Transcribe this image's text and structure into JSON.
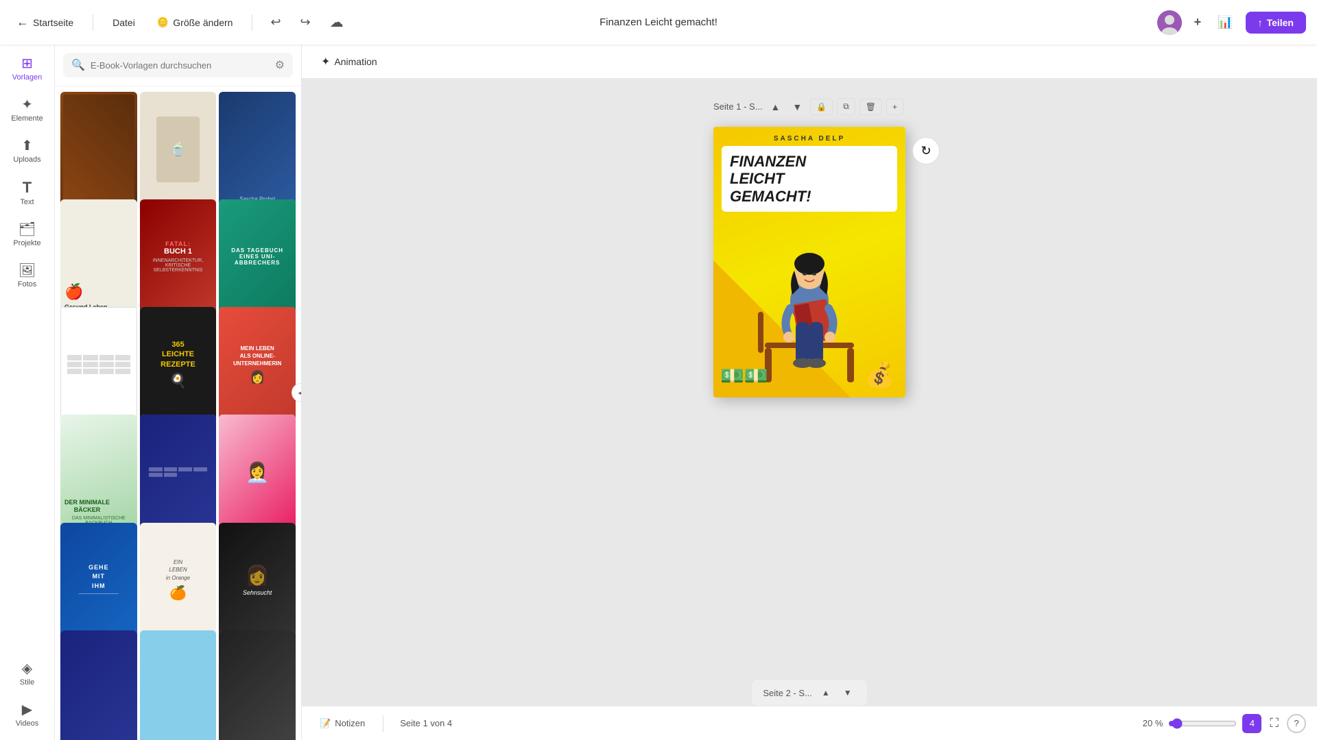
{
  "header": {
    "home_label": "Startseite",
    "file_label": "Datei",
    "resize_label": "Größe ändern",
    "undo_icon": "↩",
    "redo_icon": "↪",
    "cloud_icon": "☁",
    "title": "Finanzen Leicht gemacht!",
    "plus_icon": "+",
    "chart_icon": "📊",
    "share_label": "Teilen"
  },
  "sidebar": {
    "items": [
      {
        "id": "vorlagen",
        "label": "Vorlagen",
        "icon": "⊞",
        "active": true
      },
      {
        "id": "elemente",
        "label": "Elemente",
        "icon": "✦"
      },
      {
        "id": "uploads",
        "label": "Uploads",
        "icon": "⬆"
      },
      {
        "id": "text",
        "label": "Text",
        "icon": "T"
      },
      {
        "id": "projekte",
        "label": "Projekte",
        "icon": "□"
      },
      {
        "id": "fotos",
        "label": "Fotos",
        "icon": "🖼"
      },
      {
        "id": "stile",
        "label": "Stile",
        "icon": "◈"
      },
      {
        "id": "videos",
        "label": "Videos",
        "icon": "▶"
      }
    ]
  },
  "panel": {
    "search_placeholder": "E-Book-Vorlagen durchsuchen",
    "filter_icon": "⚙",
    "books": [
      {
        "id": 1,
        "title": "",
        "style": "book-cover-1"
      },
      {
        "id": 2,
        "title": "",
        "style": "book-cover-2"
      },
      {
        "id": 3,
        "title": "Sascha Probst",
        "style": "book-cover-3"
      },
      {
        "id": 4,
        "title": "Gesund Leben",
        "style": "book-cover-4"
      },
      {
        "id": 5,
        "title": "FATAL: BUCH 1",
        "style": "book-cover-5"
      },
      {
        "id": 6,
        "title": "DAS TAGEBUCH EINES UNI-ABBRECHERS",
        "style": "book-cover-6"
      },
      {
        "id": 7,
        "title": "",
        "style": "book-cover-7"
      },
      {
        "id": 8,
        "title": "365 LEICHTE REZEPTE",
        "style": "book-cover-8"
      },
      {
        "id": 9,
        "title": "MEIN LEBEN ALS ONLINE-UNTERNEHMERIN",
        "style": "book-cover-9"
      },
      {
        "id": 10,
        "title": "DER MINIMALE BÄCKER",
        "style": "book-cover-10"
      },
      {
        "id": 11,
        "title": "",
        "style": "book-cover-11"
      },
      {
        "id": 12,
        "title": "",
        "style": "book-cover-12"
      },
      {
        "id": 13,
        "title": "GEHE MIT IHM",
        "style": "book-cover-13"
      },
      {
        "id": 14,
        "title": "EIN LEBEN in Orange",
        "style": "book-cover-14"
      },
      {
        "id": 15,
        "title": "SEHNSUCHT",
        "style": "book-cover-15"
      },
      {
        "id": 16,
        "title": "",
        "style": "book-cover-16"
      },
      {
        "id": 17,
        "title": "",
        "style": "book-cover-17"
      },
      {
        "id": 18,
        "title": "",
        "style": "book-cover-18"
      }
    ]
  },
  "canvas": {
    "animation_label": "Animation",
    "page1_label": "Seite 1 - S...",
    "page2_label": "Seite 2 - S...",
    "ebook": {
      "author": "SASCHA DELP",
      "title_line1": "FINANZEN",
      "title_line2": "LEICHT",
      "title_line3": "GEMACHT!"
    }
  },
  "bottombar": {
    "notes_label": "Notizen",
    "page_indicator": "Seite 1 von 4",
    "zoom_percent": "20 %",
    "zoom_value": 20,
    "page_count": "4",
    "fullscreen_icon": "⛶",
    "help_icon": "?"
  }
}
